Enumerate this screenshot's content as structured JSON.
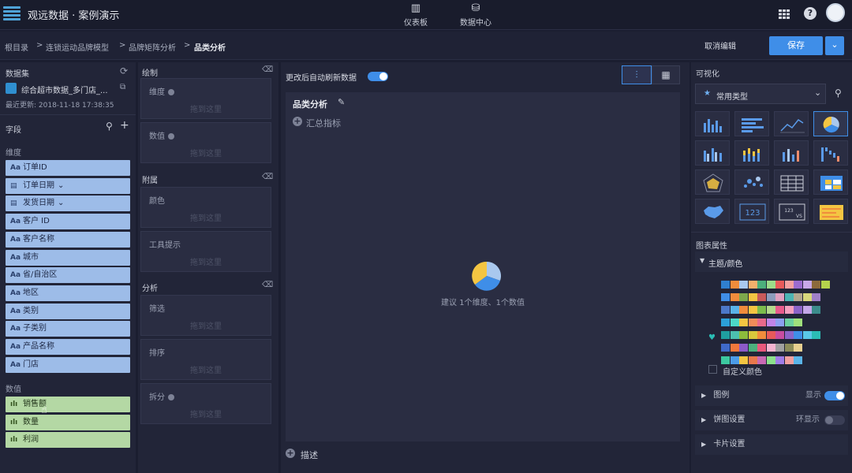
{
  "app": {
    "title": "观远数据 · 案例演示"
  },
  "nav": {
    "dashboard": "仪表板",
    "datacenter": "数据中心"
  },
  "breadcrumb": [
    "根目录",
    ">",
    "连锁运动品牌模型",
    ">",
    "品牌矩阵分析",
    ">",
    "品类分析"
  ],
  "header": {
    "cancel": "取消编辑",
    "save": "保存"
  },
  "dataset": {
    "label": "数据集",
    "name": "综合超市数据_多门店_...",
    "updated": "最近更新: 2018-11-18 17:38:35"
  },
  "fields": {
    "label": "字段",
    "dim_label": "维度",
    "dims": [
      "订单ID",
      "订单日期",
      "发货日期",
      "客户 ID",
      "客户名称",
      "城市",
      "省/自治区",
      "地区",
      "类别",
      "子类别",
      "产品名称",
      "门店"
    ],
    "measure_label": "数值",
    "measures": [
      "销售额",
      "数量",
      "利润"
    ]
  },
  "draw": {
    "label": "绘制",
    "dim": "维度",
    "val": "数值",
    "attach": "附属",
    "color": "颜色",
    "tooltip": "工具提示",
    "analysis": "分析",
    "filter": "筛选",
    "sort": "排序",
    "split": "拆分",
    "hint": "拖到这里"
  },
  "canvas": {
    "auto_refresh": "更改后自动刷新数据",
    "chart_title": "品类分析",
    "summary": "汇总指标",
    "suggestion": "建议 1个维度、1个数值",
    "describe": "描述"
  },
  "viz": {
    "label": "可视化",
    "type_select": "常用类型",
    "props_label": "图表属性",
    "theme": "主题/颜色",
    "custom_color": "自定义颜色",
    "legend": "图例",
    "legend_toggle": "显示",
    "pie_settings": "饼图设置",
    "ring_toggle": "环显示",
    "card_settings": "卡片设置",
    "number_icon": "123",
    "kpi_icon": "123"
  },
  "colors": {
    "accent": "#3f8ee8",
    "dim_field": "#9dbce8",
    "measure_field": "#b4d8a4"
  }
}
